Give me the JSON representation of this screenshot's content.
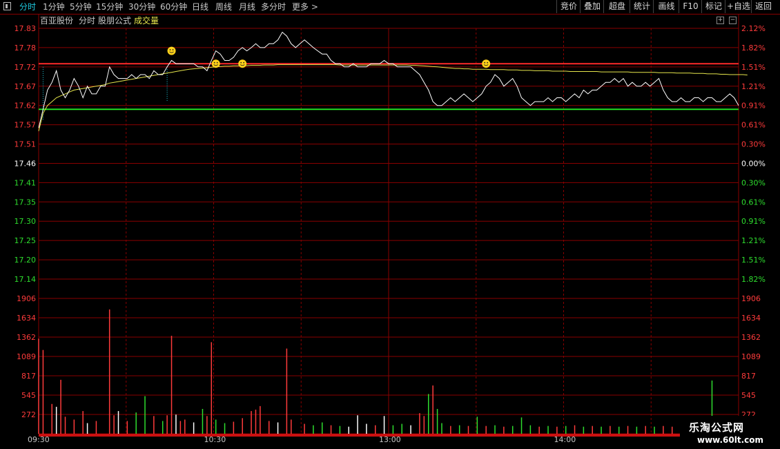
{
  "toolbar": {
    "periods": [
      "分时",
      "1分钟",
      "5分钟",
      "15分钟",
      "30分钟",
      "60分钟",
      "日线",
      "周线",
      "月线",
      "多分时",
      "更多 >"
    ],
    "active_index": 0,
    "buttons": [
      "竞价",
      "叠加",
      "超盘",
      "统计",
      "画线",
      "F10",
      "标记",
      "+自选",
      "返回"
    ]
  },
  "subheader": {
    "stock_name": "百亚股份",
    "mode": "分时",
    "formula": "股朋公式",
    "indicator": "成交量"
  },
  "colors": {
    "up": "#ff3b3b",
    "down": "#2ede2e",
    "neutral": "#ffffff",
    "grid": "#8a0000",
    "price_line": "#ffffff",
    "avg_line": "#e6e64c",
    "accent": "#1ecbe1"
  },
  "chart_data": {
    "type": "line",
    "title": "",
    "price_axis": {
      "labels": [
        "17.83",
        "17.78",
        "17.72",
        "17.67",
        "17.62",
        "17.57",
        "17.51",
        "17.46",
        "17.41",
        "17.35",
        "17.30",
        "17.25",
        "17.20",
        "17.14"
      ],
      "pct_labels": [
        "2.12%",
        "1.82%",
        "1.51%",
        "1.21%",
        "0.91%",
        "0.61%",
        "0.30%",
        "0.00%",
        "0.30%",
        "0.61%",
        "0.91%",
        "1.21%",
        "1.51%",
        "1.82%"
      ],
      "ylim": [
        17.1,
        17.85
      ],
      "prev_close": 17.46
    },
    "volume_axis": {
      "labels": [
        "1906",
        "1634",
        "1362",
        "1089",
        "817",
        "545",
        "272"
      ],
      "ylim": [
        0,
        2000
      ]
    },
    "time_labels": [
      "09:30",
      "10:30",
      "13:00",
      "14:00"
    ],
    "reference_lines": [
      {
        "name": "red",
        "value": 17.73,
        "color": "#ff2a2a"
      },
      {
        "name": "green",
        "value": 17.61,
        "color": "#22e022"
      }
    ],
    "price": [
      17.56,
      17.61,
      17.66,
      17.68,
      17.71,
      17.66,
      17.64,
      17.66,
      17.69,
      17.67,
      17.64,
      17.67,
      17.65,
      17.65,
      17.67,
      17.67,
      17.72,
      17.7,
      17.69,
      17.69,
      17.69,
      17.7,
      17.69,
      17.7,
      17.7,
      17.69,
      17.71,
      17.7,
      17.7,
      17.72,
      17.74,
      17.73,
      17.73,
      17.73,
      17.73,
      17.73,
      17.72,
      17.72,
      17.71,
      17.74,
      17.77,
      17.76,
      17.74,
      17.74,
      17.75,
      17.77,
      17.78,
      17.77,
      17.78,
      17.79,
      17.78,
      17.78,
      17.79,
      17.79,
      17.8,
      17.82,
      17.81,
      17.79,
      17.78,
      17.79,
      17.8,
      17.79,
      17.78,
      17.77,
      17.76,
      17.76,
      17.74,
      17.73,
      17.73,
      17.72,
      17.72,
      17.73,
      17.72,
      17.72,
      17.72,
      17.73,
      17.73,
      17.73,
      17.74,
      17.73,
      17.73,
      17.72,
      17.72,
      17.72,
      17.72,
      17.71,
      17.7,
      17.68,
      17.66,
      17.63,
      17.62,
      17.62,
      17.63,
      17.64,
      17.63,
      17.64,
      17.65,
      17.64,
      17.63,
      17.64,
      17.65,
      17.67,
      17.68,
      17.7,
      17.69,
      17.67,
      17.68,
      17.69,
      17.67,
      17.64,
      17.63,
      17.62,
      17.63,
      17.63,
      17.63,
      17.64,
      17.63,
      17.64,
      17.64,
      17.63,
      17.64,
      17.65,
      17.64,
      17.66,
      17.65,
      17.66,
      17.66,
      17.67,
      17.68,
      17.68,
      17.69,
      17.68,
      17.69,
      17.67,
      17.68,
      17.67,
      17.67,
      17.68,
      17.67,
      17.68,
      17.69,
      17.66,
      17.64,
      17.63,
      17.63,
      17.64,
      17.63,
      17.63,
      17.64,
      17.64,
      17.63,
      17.64,
      17.64,
      17.63,
      17.63,
      17.64,
      17.65,
      17.64,
      17.62
    ],
    "avg": [
      17.55,
      17.6,
      17.62,
      17.63,
      17.64,
      17.645,
      17.65,
      17.655,
      17.66,
      17.662,
      17.664,
      17.666,
      17.668,
      17.67,
      17.672,
      17.674,
      17.678,
      17.68,
      17.682,
      17.684,
      17.686,
      17.688,
      17.69,
      17.692,
      17.694,
      17.696,
      17.698,
      17.7,
      17.702,
      17.704,
      17.706,
      17.708,
      17.71,
      17.712,
      17.714,
      17.715,
      17.716,
      17.717,
      17.718,
      17.719,
      17.72,
      17.721,
      17.722,
      17.722,
      17.723,
      17.723,
      17.724,
      17.724,
      17.725,
      17.725,
      17.725,
      17.726,
      17.726,
      17.726,
      17.727,
      17.727,
      17.727,
      17.727,
      17.727,
      17.727,
      17.727,
      17.727,
      17.727,
      17.727,
      17.727,
      17.727,
      17.727,
      17.727,
      17.726,
      17.726,
      17.726,
      17.726,
      17.726,
      17.726,
      17.726,
      17.726,
      17.726,
      17.726,
      17.726,
      17.726,
      17.726,
      17.726,
      17.726,
      17.726,
      17.725,
      17.725,
      17.724,
      17.723,
      17.722,
      17.721,
      17.72,
      17.719,
      17.718,
      17.717,
      17.716,
      17.716,
      17.715,
      17.715,
      17.714,
      17.714,
      17.714,
      17.714,
      17.713,
      17.713,
      17.713,
      17.713,
      17.712,
      17.712,
      17.712,
      17.711,
      17.711,
      17.711,
      17.71,
      17.71,
      17.71,
      17.71,
      17.709,
      17.709,
      17.709,
      17.709,
      17.708,
      17.708,
      17.708,
      17.708,
      17.708,
      17.708,
      17.708,
      17.707,
      17.707,
      17.707,
      17.707,
      17.707,
      17.707,
      17.707,
      17.706,
      17.706,
      17.706,
      17.706,
      17.706,
      17.706,
      17.705,
      17.705,
      17.705,
      17.705,
      17.704,
      17.704,
      17.704,
      17.704,
      17.703,
      17.703,
      17.703,
      17.702,
      17.702,
      17.702,
      17.701,
      17.701,
      17.7,
      17.7,
      17.7,
      17.7,
      17.699
    ],
    "volume": [
      {
        "i": 0,
        "v": 1340,
        "c": "up"
      },
      {
        "i": 1,
        "v": 1180,
        "c": "up"
      },
      {
        "i": 3,
        "v": 420,
        "c": "up"
      },
      {
        "i": 4,
        "v": 380,
        "c": "neutral"
      },
      {
        "i": 5,
        "v": 760,
        "c": "up"
      },
      {
        "i": 6,
        "v": 240,
        "c": "up"
      },
      {
        "i": 8,
        "v": 200,
        "c": "up"
      },
      {
        "i": 10,
        "v": 320,
        "c": "up"
      },
      {
        "i": 11,
        "v": 150,
        "c": "neutral"
      },
      {
        "i": 13,
        "v": 180,
        "c": "up"
      },
      {
        "i": 16,
        "v": 1750,
        "c": "up"
      },
      {
        "i": 17,
        "v": 260,
        "c": "up"
      },
      {
        "i": 18,
        "v": 320,
        "c": "neutral"
      },
      {
        "i": 20,
        "v": 180,
        "c": "up"
      },
      {
        "i": 22,
        "v": 300,
        "c": "down"
      },
      {
        "i": 24,
        "v": 530,
        "c": "down"
      },
      {
        "i": 26,
        "v": 250,
        "c": "up"
      },
      {
        "i": 28,
        "v": 180,
        "c": "down"
      },
      {
        "i": 29,
        "v": 260,
        "c": "up"
      },
      {
        "i": 30,
        "v": 1380,
        "c": "up"
      },
      {
        "i": 31,
        "v": 270,
        "c": "neutral"
      },
      {
        "i": 32,
        "v": 180,
        "c": "up"
      },
      {
        "i": 33,
        "v": 200,
        "c": "up"
      },
      {
        "i": 35,
        "v": 160,
        "c": "neutral"
      },
      {
        "i": 37,
        "v": 350,
        "c": "down"
      },
      {
        "i": 38,
        "v": 250,
        "c": "up"
      },
      {
        "i": 39,
        "v": 1290,
        "c": "up"
      },
      {
        "i": 40,
        "v": 200,
        "c": "down"
      },
      {
        "i": 42,
        "v": 150,
        "c": "down"
      },
      {
        "i": 44,
        "v": 170,
        "c": "up"
      },
      {
        "i": 46,
        "v": 220,
        "c": "up"
      },
      {
        "i": 48,
        "v": 320,
        "c": "up"
      },
      {
        "i": 49,
        "v": 340,
        "c": "up"
      },
      {
        "i": 50,
        "v": 390,
        "c": "up"
      },
      {
        "i": 52,
        "v": 180,
        "c": "up"
      },
      {
        "i": 54,
        "v": 160,
        "c": "neutral"
      },
      {
        "i": 56,
        "v": 1200,
        "c": "up"
      },
      {
        "i": 57,
        "v": 200,
        "c": "up"
      },
      {
        "i": 60,
        "v": 140,
        "c": "up"
      },
      {
        "i": 62,
        "v": 120,
        "c": "down"
      },
      {
        "i": 64,
        "v": 160,
        "c": "down"
      },
      {
        "i": 66,
        "v": 120,
        "c": "up"
      },
      {
        "i": 68,
        "v": 110,
        "c": "down"
      },
      {
        "i": 70,
        "v": 100,
        "c": "neutral"
      },
      {
        "i": 72,
        "v": 260,
        "c": "neutral"
      },
      {
        "i": 74,
        "v": 140,
        "c": "neutral"
      },
      {
        "i": 76,
        "v": 120,
        "c": "up"
      },
      {
        "i": 78,
        "v": 250,
        "c": "neutral"
      },
      {
        "i": 80,
        "v": 120,
        "c": "down"
      },
      {
        "i": 82,
        "v": 140,
        "c": "down"
      },
      {
        "i": 84,
        "v": 120,
        "c": "neutral"
      },
      {
        "i": 86,
        "v": 290,
        "c": "up"
      },
      {
        "i": 87,
        "v": 250,
        "c": "up"
      },
      {
        "i": 88,
        "v": 560,
        "c": "down"
      },
      {
        "i": 89,
        "v": 680,
        "c": "up"
      },
      {
        "i": 90,
        "v": 350,
        "c": "down"
      },
      {
        "i": 91,
        "v": 150,
        "c": "down"
      },
      {
        "i": 93,
        "v": 110,
        "c": "up"
      },
      {
        "i": 95,
        "v": 120,
        "c": "down"
      },
      {
        "i": 97,
        "v": 110,
        "c": "up"
      },
      {
        "i": 99,
        "v": 240,
        "c": "down"
      },
      {
        "i": 101,
        "v": 110,
        "c": "up"
      },
      {
        "i": 103,
        "v": 120,
        "c": "down"
      },
      {
        "i": 105,
        "v": 100,
        "c": "up"
      },
      {
        "i": 107,
        "v": 110,
        "c": "down"
      },
      {
        "i": 109,
        "v": 230,
        "c": "down"
      },
      {
        "i": 111,
        "v": 120,
        "c": "down"
      },
      {
        "i": 113,
        "v": 100,
        "c": "up"
      },
      {
        "i": 115,
        "v": 110,
        "c": "down"
      },
      {
        "i": 117,
        "v": 100,
        "c": "up"
      },
      {
        "i": 119,
        "v": 110,
        "c": "down"
      },
      {
        "i": 121,
        "v": 120,
        "c": "up"
      },
      {
        "i": 123,
        "v": 100,
        "c": "down"
      },
      {
        "i": 125,
        "v": 110,
        "c": "up"
      },
      {
        "i": 127,
        "v": 100,
        "c": "down"
      },
      {
        "i": 129,
        "v": 110,
        "c": "up"
      },
      {
        "i": 131,
        "v": 100,
        "c": "down"
      },
      {
        "i": 133,
        "v": 110,
        "c": "up"
      },
      {
        "i": 135,
        "v": 100,
        "c": "down"
      },
      {
        "i": 137,
        "v": 110,
        "c": "up"
      },
      {
        "i": 139,
        "v": 100,
        "c": "down"
      },
      {
        "i": 141,
        "v": 110,
        "c": "up"
      },
      {
        "i": 143,
        "v": 100,
        "c": "up"
      },
      {
        "i": 145,
        "v": 110,
        "c": "down"
      },
      {
        "i": 147,
        "v": 100,
        "c": "up"
      },
      {
        "i": 149,
        "v": 110,
        "c": "down"
      },
      {
        "i": 151,
        "v": 230,
        "c": "neutral"
      },
      {
        "i": 152,
        "v": 750,
        "c": "down"
      },
      {
        "i": 154,
        "v": 200,
        "c": "down"
      },
      {
        "i": 156,
        "v": 120,
        "c": "up"
      },
      {
        "i": 158,
        "v": 110,
        "c": "neutral"
      }
    ],
    "markers": [
      {
        "i": 30,
        "v": 17.77
      },
      {
        "i": 40,
        "v": 17.73
      },
      {
        "i": 46,
        "v": 17.73
      },
      {
        "i": 101,
        "v": 17.73
      }
    ],
    "vertical_markers": [
      {
        "i": 1,
        "from": 17.72,
        "to": 17.58
      },
      {
        "i": 29,
        "from": 17.72,
        "to": 17.63
      }
    ]
  },
  "watermark": {
    "line1": "乐淘公式网",
    "line2": "www.60lt.com"
  }
}
